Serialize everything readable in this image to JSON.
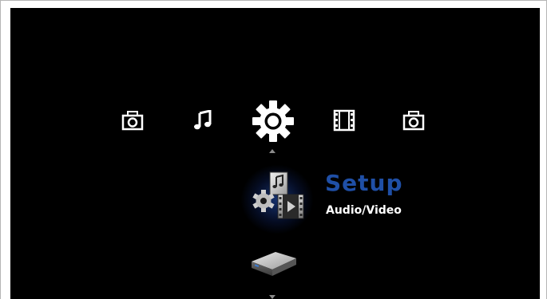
{
  "menu": {
    "icons": [
      {
        "name": "photo",
        "icon": "camera-icon"
      },
      {
        "name": "music",
        "icon": "music-note-icon"
      },
      {
        "name": "setup",
        "icon": "gear-icon",
        "selected": true
      },
      {
        "name": "movie",
        "icon": "film-strip-icon"
      },
      {
        "name": "photo",
        "icon": "camera-icon"
      }
    ]
  },
  "selection": {
    "title": "Setup",
    "subtitle": "Audio/Video",
    "icon": "setup-media-icon",
    "next_item_icon": "hard-drive-icon"
  },
  "colors": {
    "background": "#000000",
    "title": "#1f4fa6",
    "subtitle": "#ffffff",
    "icon": "#ffffff",
    "glow": "#2a5bd7"
  }
}
